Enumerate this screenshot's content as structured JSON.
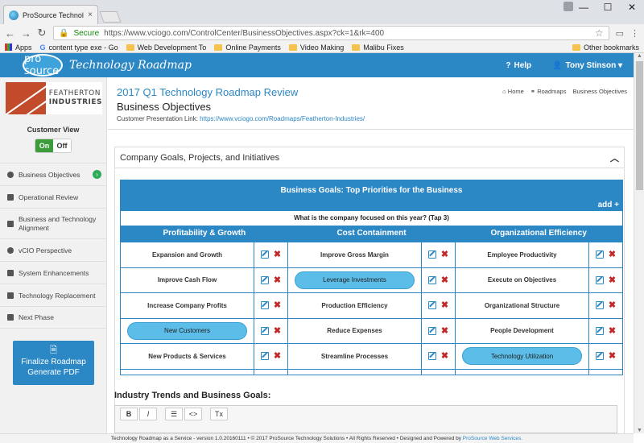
{
  "browser": {
    "tab_title": "ProSource Technology Ro",
    "tab_close": "×",
    "window_controls": [
      "—",
      "☐",
      "✕"
    ],
    "secure_label": "Secure",
    "url": "https://www.vciogo.com/ControlCenter/BusinessObjectives.aspx?ck=1&rk=400",
    "bookmarks": [
      "Apps",
      "content type exe - Go",
      "Web Development To",
      "Online Payments",
      "Video Making",
      "Malibu Fixes"
    ],
    "other_bookmarks": "Other bookmarks"
  },
  "header": {
    "logo_word": "pro source",
    "product": "Technology Roadmap",
    "help": "Help",
    "user": "Tony Stinson ▾"
  },
  "sidebar": {
    "company_line1": "FEATHERTON",
    "company_line2": "INDUSTRIES",
    "customer_view_label": "Customer View",
    "toggle_on": "On",
    "toggle_off": "Off",
    "items": [
      {
        "label": "Business Objectives"
      },
      {
        "label": "Operational Review"
      },
      {
        "label": "Business and Technology Alignment"
      },
      {
        "label": "vCIO Perspective"
      },
      {
        "label": "System Enhancements"
      },
      {
        "label": "Technology Replacement"
      },
      {
        "label": "Next Phase"
      }
    ],
    "finalize_line1": "Finalize Roadmap",
    "finalize_line2": "Generate PDF"
  },
  "page": {
    "title": "2017 Q1 Technology Roadmap Review",
    "subtitle": "Business Objectives",
    "link_label": "Customer Presentation Link:",
    "link_url": "https://www.vciogo.com/Roadmaps/Featherton-Industries/",
    "breadcrumbs": [
      "Home",
      "Roadmaps",
      "Business Objectives"
    ]
  },
  "panel": {
    "title": "Company Goals, Projects, and Initiatives",
    "goals_title": "Business Goals: Top Priorities for the Business",
    "add_label": "add +",
    "question": "What is the company focused on this year? (Tap 3)",
    "columns": [
      "Profitability & Growth",
      "Cost Containment",
      "Organizational Efficiency"
    ],
    "rows": [
      [
        "Expansion and Growth",
        "Improve Gross Margin",
        "Employee Productivity"
      ],
      [
        "Improve Cash Flow",
        "Leverage Investments",
        "Execute on Objectives"
      ],
      [
        "Increase Company Profits",
        "Production Efficiency",
        "Organizational Structure"
      ],
      [
        "New Customers",
        "Reduce Expenses",
        "People Development"
      ],
      [
        "New Products & Services",
        "Streamline Processes",
        "Technology Utilization"
      ]
    ],
    "selected": [
      "Leverage Investments",
      "New Customers",
      "Technology Utilization"
    ],
    "trends_label": "Industry Trends and Business Goals:",
    "editor_buttons": [
      "B",
      "I",
      "☰",
      "<>",
      "Tx"
    ]
  },
  "footer": {
    "text": "Technology Roadmap as a Service - version 1.0.20160111 • © 2017 ProSource Technology Solutions • All Rights Reserved • Designed and Powered by",
    "link": "ProSource Web Services."
  }
}
